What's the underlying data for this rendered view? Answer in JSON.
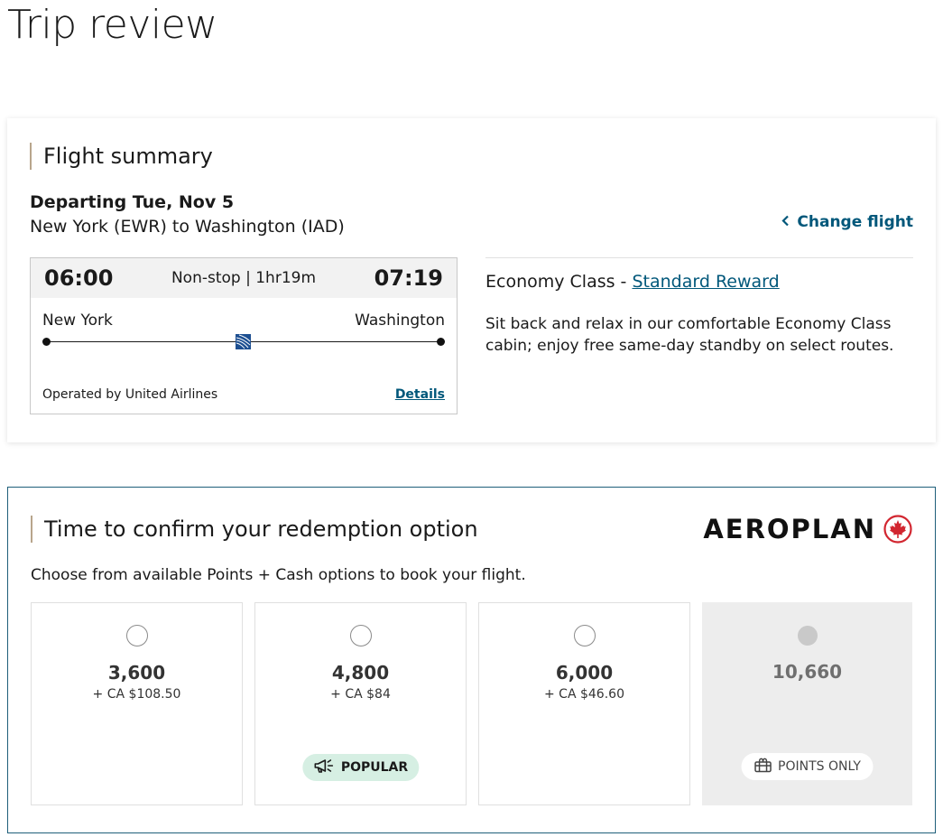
{
  "page": {
    "title": "Trip review"
  },
  "summary": {
    "heading": "Flight summary",
    "departing": "Departing Tue, Nov 5",
    "route": "New York (EWR) to Washington (IAD)",
    "change_flight": "Change flight",
    "flight": {
      "dep_time": "06:00",
      "arr_time": "07:19",
      "nonstop": "Non-stop | 1hr19m",
      "origin": "New York",
      "destination": "Washington",
      "operated_by": "Operated by United Airlines",
      "details": "Details"
    },
    "fare": {
      "class_label": "Economy Class - ",
      "reward_link": "Standard Reward",
      "description": "Sit back and relax in our comfortable Economy Class cabin; enjoy free same-day standby on select routes."
    }
  },
  "redemption": {
    "heading": "Time to confirm your redemption option",
    "brand": "AEROPLAN",
    "instructions": "Choose from available Points + Cash options to book your flight.",
    "options": [
      {
        "points": "3,600",
        "cash": "+ CA $108.50"
      },
      {
        "points": "4,800",
        "cash": "+ CA $84",
        "badge": "POPULAR"
      },
      {
        "points": "6,000",
        "cash": "+ CA $46.60"
      },
      {
        "points": "10,660",
        "badge": "POINTS ONLY"
      }
    ]
  },
  "colors": {
    "link": "#00577a",
    "accent_border": "#b8a58c",
    "card_border": "#1f5f7a",
    "popular_bg": "#d6efe3",
    "maple_red": "#d22630"
  },
  "icons": [
    "chevron-left-icon",
    "united-airlines-logo-icon",
    "maple-leaf-icon",
    "megaphone-icon",
    "gift-icon"
  ]
}
